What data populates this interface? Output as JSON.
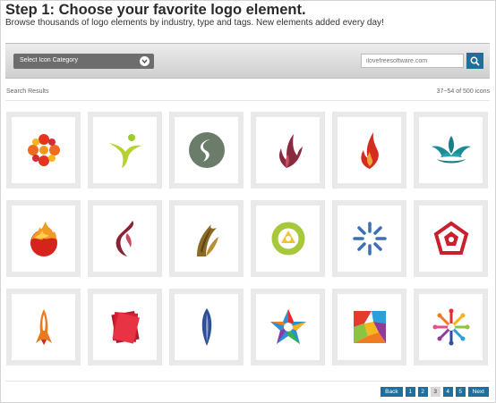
{
  "header": {
    "title": "Step 1: Choose your favorite logo element.",
    "subtitle": "Browse thousands of logo elements by industry, type and tags. New elements added every day!"
  },
  "toolbar": {
    "category_select": "Select Icon Category",
    "search_placeholder": "ilovefreesoftware.com"
  },
  "results": {
    "label": "Search Results",
    "count": "37~54 of 500 icons"
  },
  "icons": [
    {
      "name": "orange-red-flower-icon"
    },
    {
      "name": "green-figure-icon"
    },
    {
      "name": "gray-s-circle-icon"
    },
    {
      "name": "maroon-leaf-flame-icon"
    },
    {
      "name": "red-flame-icon"
    },
    {
      "name": "teal-lotus-icon"
    },
    {
      "name": "red-fireball-icon"
    },
    {
      "name": "maroon-swoosh-icon"
    },
    {
      "name": "brown-leaf-icon"
    },
    {
      "name": "green-ring-icon"
    },
    {
      "name": "blue-starburst-icon"
    },
    {
      "name": "red-pentagon-icon"
    },
    {
      "name": "orange-rocket-icon"
    },
    {
      "name": "red-pages-icon"
    },
    {
      "name": "blue-feather-icon"
    },
    {
      "name": "colorful-star-icon"
    },
    {
      "name": "colorful-square-icon"
    },
    {
      "name": "colorful-people-circle-icon"
    }
  ],
  "pagination": {
    "back": "Back",
    "pages": [
      "1",
      "2",
      "3",
      "4",
      "5"
    ],
    "current_page": "3",
    "next": "Next"
  },
  "colors": {
    "accent": "#1f6f9a",
    "tile_border": "#e9e9e9",
    "toolbar": "#d8d8d8"
  }
}
